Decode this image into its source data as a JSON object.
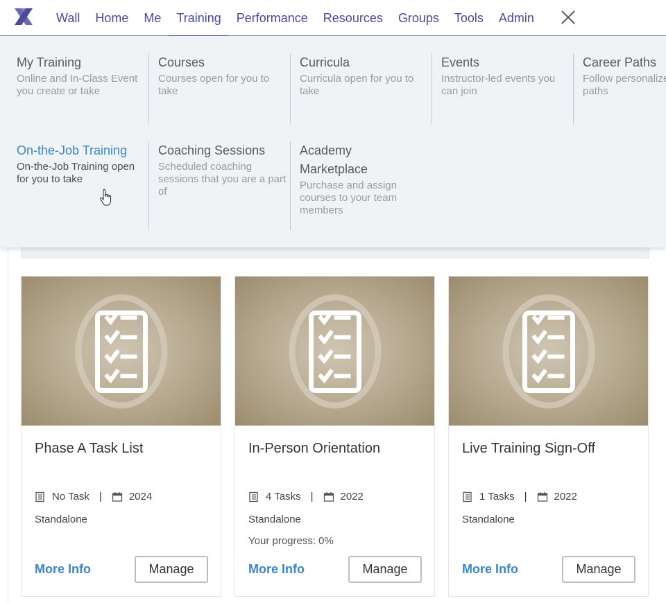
{
  "nav": {
    "items": [
      {
        "label": "Wall"
      },
      {
        "label": "Home"
      },
      {
        "label": "Me"
      },
      {
        "label": "Training",
        "active": true
      },
      {
        "label": "Performance"
      },
      {
        "label": "Resources"
      },
      {
        "label": "Groups"
      },
      {
        "label": "Tools"
      },
      {
        "label": "Admin"
      }
    ],
    "brand_color": "#4b4a9b"
  },
  "dropdown": {
    "row1": [
      {
        "title": "My Training",
        "desc": "Online and In-Class Event you create or take"
      },
      {
        "title": "Courses",
        "desc": "Courses open for you to take"
      },
      {
        "title": "Curricula",
        "desc": "Curricula open for you to take"
      },
      {
        "title": "Events",
        "desc": "Instructor-led events you can join"
      },
      {
        "title": "Career Paths",
        "desc": "Follow personalized career paths"
      }
    ],
    "row2": [
      {
        "title": "On-the-Job Training",
        "desc": "On-the-Job Training open for you to take",
        "highlighted": true
      },
      {
        "title": "Coaching Sessions",
        "desc": "Scheduled coaching sessions that you are a part of"
      },
      {
        "title": "Academy Marketplace",
        "desc": "Purchase and assign courses to your team members"
      }
    ]
  },
  "cards": [
    {
      "title": "Phase A Task List",
      "tasks": "No Task",
      "year": "2024",
      "type": "Standalone",
      "progress": "",
      "more": "More Info",
      "manage": "Manage"
    },
    {
      "title": "In-Person Orientation",
      "tasks": "4 Tasks",
      "year": "2022",
      "type": "Standalone",
      "progress": "Your progress:  0%",
      "more": "More Info",
      "manage": "Manage"
    },
    {
      "title": "Live Training Sign-Off",
      "tasks": "1 Tasks",
      "year": "2022",
      "type": "Standalone",
      "progress": "",
      "more": "More Info",
      "manage": "Manage"
    }
  ],
  "colors": {
    "link": "#3a86c8",
    "dropdown_bg": "#f0f3f6"
  }
}
